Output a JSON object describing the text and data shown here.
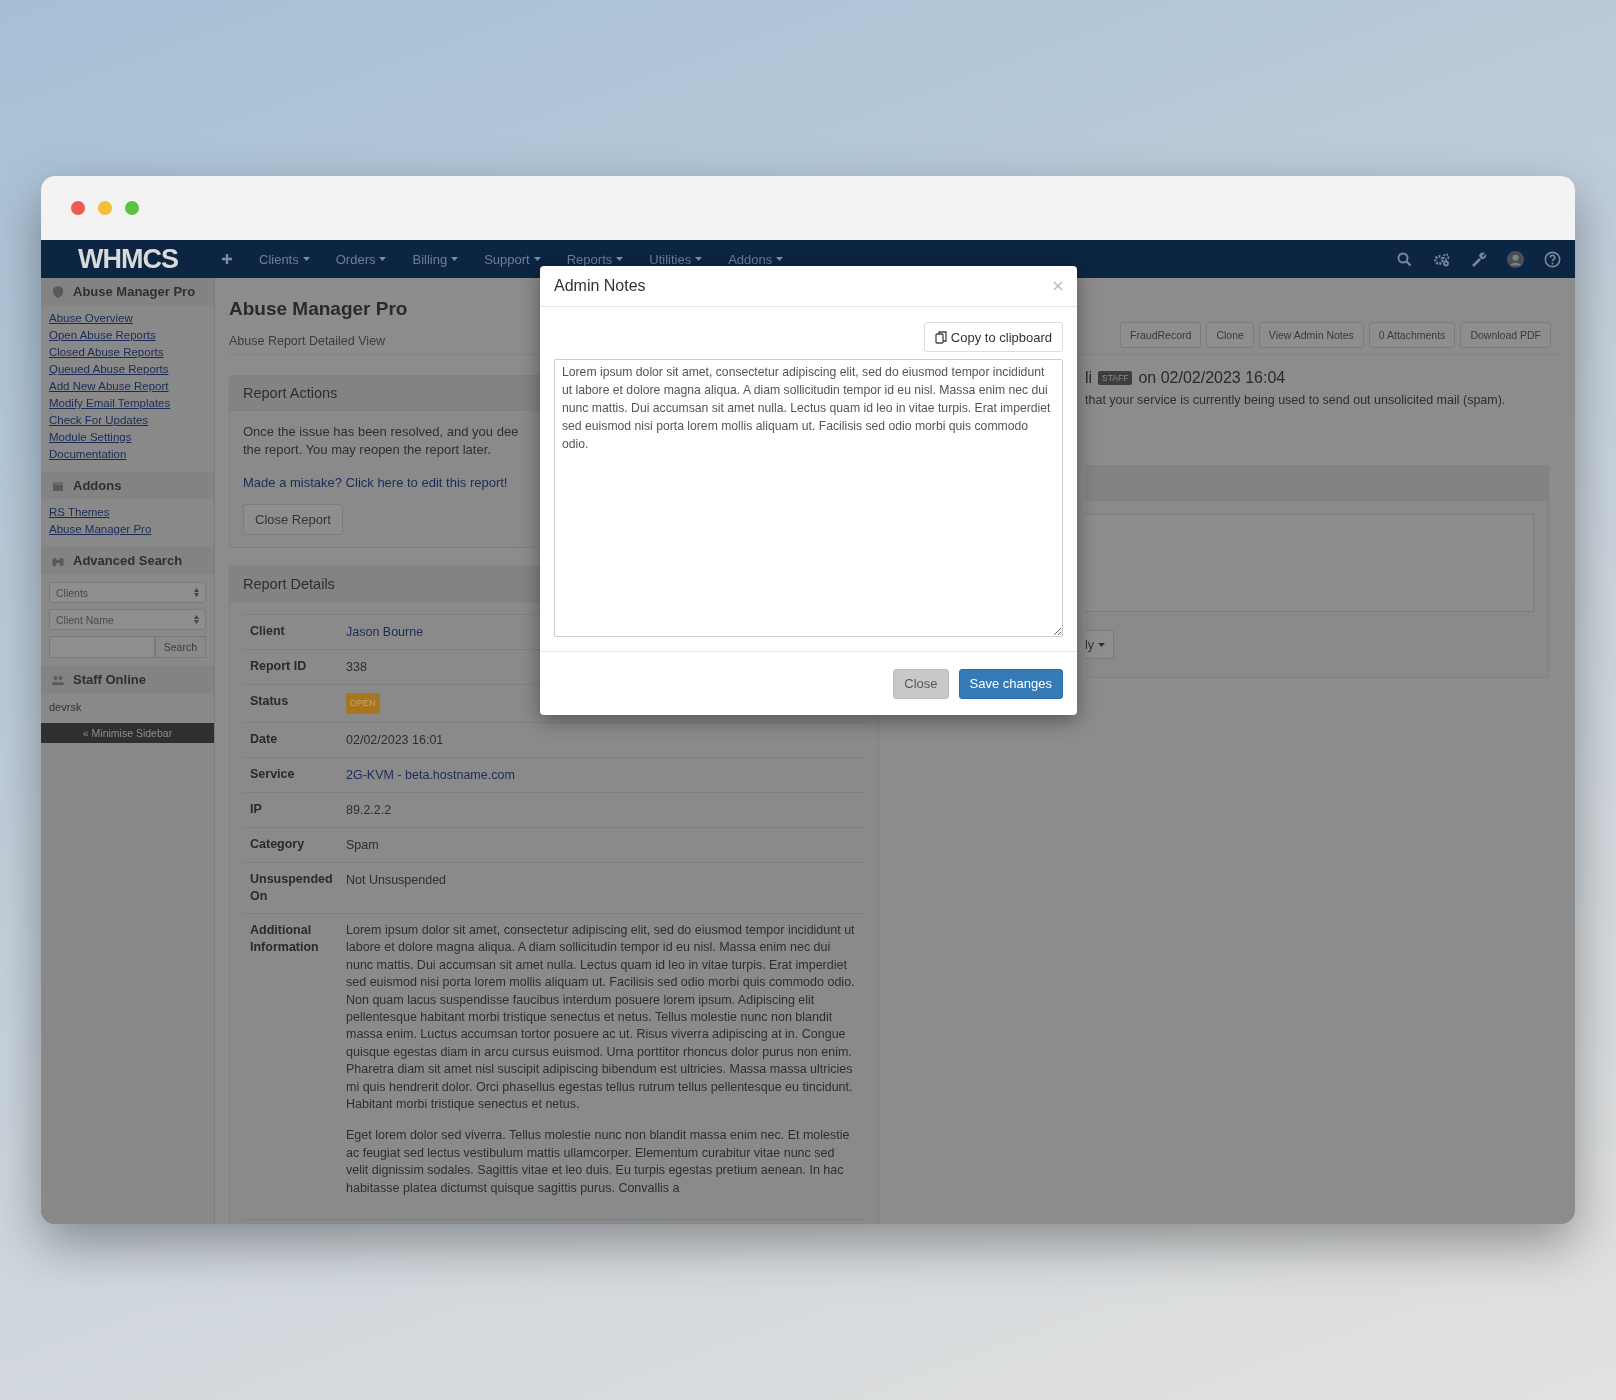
{
  "navbar": {
    "logo": "WHMCS",
    "menu": [
      {
        "label": "Clients"
      },
      {
        "label": "Orders"
      },
      {
        "label": "Billing"
      },
      {
        "label": "Support"
      },
      {
        "label": "Reports"
      },
      {
        "label": "Utilities"
      },
      {
        "label": "Addons"
      }
    ]
  },
  "sidebar": {
    "sections": [
      {
        "title": "Abuse Manager Pro",
        "kind": "links",
        "items": [
          "Abuse Overview",
          "Open Abuse Reports",
          "Closed Abuse Reports",
          "Queued Abuse Reports",
          "Add New Abuse Report",
          "Modify Email Templates",
          "Check For Updates",
          "Module Settings",
          "Documentation"
        ]
      },
      {
        "title": "Addons",
        "kind": "links",
        "items": [
          "RS Themes",
          "Abuse Manager Pro"
        ]
      },
      {
        "title": "Advanced Search",
        "kind": "search",
        "selects": [
          "Clients",
          "Client Name"
        ],
        "button": "Search"
      },
      {
        "title": "Staff Online",
        "kind": "staff",
        "items": [
          "devrsk"
        ]
      }
    ],
    "minimise": "« Minimise Sidebar"
  },
  "page": {
    "title": "Abuse Manager Pro",
    "subtitle": "Abuse Report Detailed View"
  },
  "toolbar": {
    "buttons": [
      "FraudRecord",
      "Clone",
      "View Admin Notes",
      "0 Attachments",
      "Download PDF"
    ]
  },
  "report_actions": {
    "title": "Report Actions",
    "text_lines": [
      "Once the issue has been resolved, and you dee",
      "the report. You may reopen the report later."
    ],
    "edit_link": "Made a mistake? Click here to edit this report!",
    "close_button": "Close Report"
  },
  "report_details": {
    "title": "Report Details",
    "rows": [
      {
        "label": "Client",
        "kind": "link",
        "value": "Jason Bourne"
      },
      {
        "label": "Report ID",
        "kind": "text",
        "value": "338"
      },
      {
        "label": "Status",
        "kind": "badge",
        "value": "OPEN"
      },
      {
        "label": "Date",
        "kind": "text",
        "value": "02/02/2023 16:01"
      },
      {
        "label": "Service",
        "kind": "link",
        "value": "2G-KVM - beta.hostname.com"
      },
      {
        "label": "IP",
        "kind": "text",
        "value": "89.2.2.2"
      },
      {
        "label": "Category",
        "kind": "text",
        "value": "Spam"
      },
      {
        "label": "Unsuspended On",
        "kind": "text",
        "value": "Not Unsuspended"
      },
      {
        "label": "Additional Information",
        "kind": "paragraphs",
        "paragraphs": [
          "Lorem ipsum dolor sit amet, consectetur adipiscing elit, sed do eiusmod tempor incididunt ut labore et dolore magna aliqua. A diam sollicitudin tempor id eu nisl. Massa enim nec dui nunc mattis. Dui accumsan sit amet nulla. Lectus quam id leo in vitae turpis. Erat imperdiet sed euismod nisi porta lorem mollis aliquam ut. Facilisis sed odio morbi quis commodo odio. Non quam lacus suspendisse faucibus interdum posuere lorem ipsum. Adipiscing elit pellentesque habitant morbi tristique senectus et netus. Tellus molestie nunc non blandit massa enim. Luctus accumsan tortor posuere ac ut. Risus viverra adipiscing at in. Congue quisque egestas diam in arcu cursus euismod. Urna porttitor rhoncus dolor purus non enim. Pharetra diam sit amet nisl suscipit adipiscing bibendum est ultricies. Massa massa ultricies mi quis hendrerit dolor. Orci phasellus egestas tellus rutrum tellus pellentesque eu tincidunt. Habitant morbi tristique senectus et netus.",
          "Eget lorem dolor sed viverra. Tellus molestie nunc non blandit massa enim nec. Et molestie ac feugiat sed lectus vestibulum mattis ullamcorper. Elementum curabitur vitae nunc sed velit dignissim sodales. Sagittis vitae et leo duis. Eu turpis egestas pretium aenean. In hac habitasse platea dictumst quisque sagittis purus. Convallis a"
        ]
      }
    ]
  },
  "message": {
    "author_fragment": "li",
    "author_badge": "STAFF",
    "date": "on 02/02/2023 16:04",
    "body_fragment": "that your service is currently being used to send out unsolicited mail (spam)."
  },
  "reply": {
    "button_fragment": "ly"
  },
  "modal": {
    "title": "Admin Notes",
    "copy_button": "Copy to clipboard",
    "notes": "Lorem ipsum dolor sit amet, consectetur adipiscing elit, sed do eiusmod tempor incididunt ut labore et dolore magna aliqua. A diam sollicitudin tempor id eu nisl. Massa enim nec dui nunc mattis. Dui accumsan sit amet nulla. Lectus quam id leo in vitae turpis. Erat imperdiet sed euismod nisi porta lorem mollis aliquam ut. Facilisis sed odio morbi quis commodo odio.",
    "buttons": [
      {
        "label": "Close",
        "kind": "default"
      },
      {
        "label": "Save changes",
        "kind": "primary"
      }
    ]
  }
}
